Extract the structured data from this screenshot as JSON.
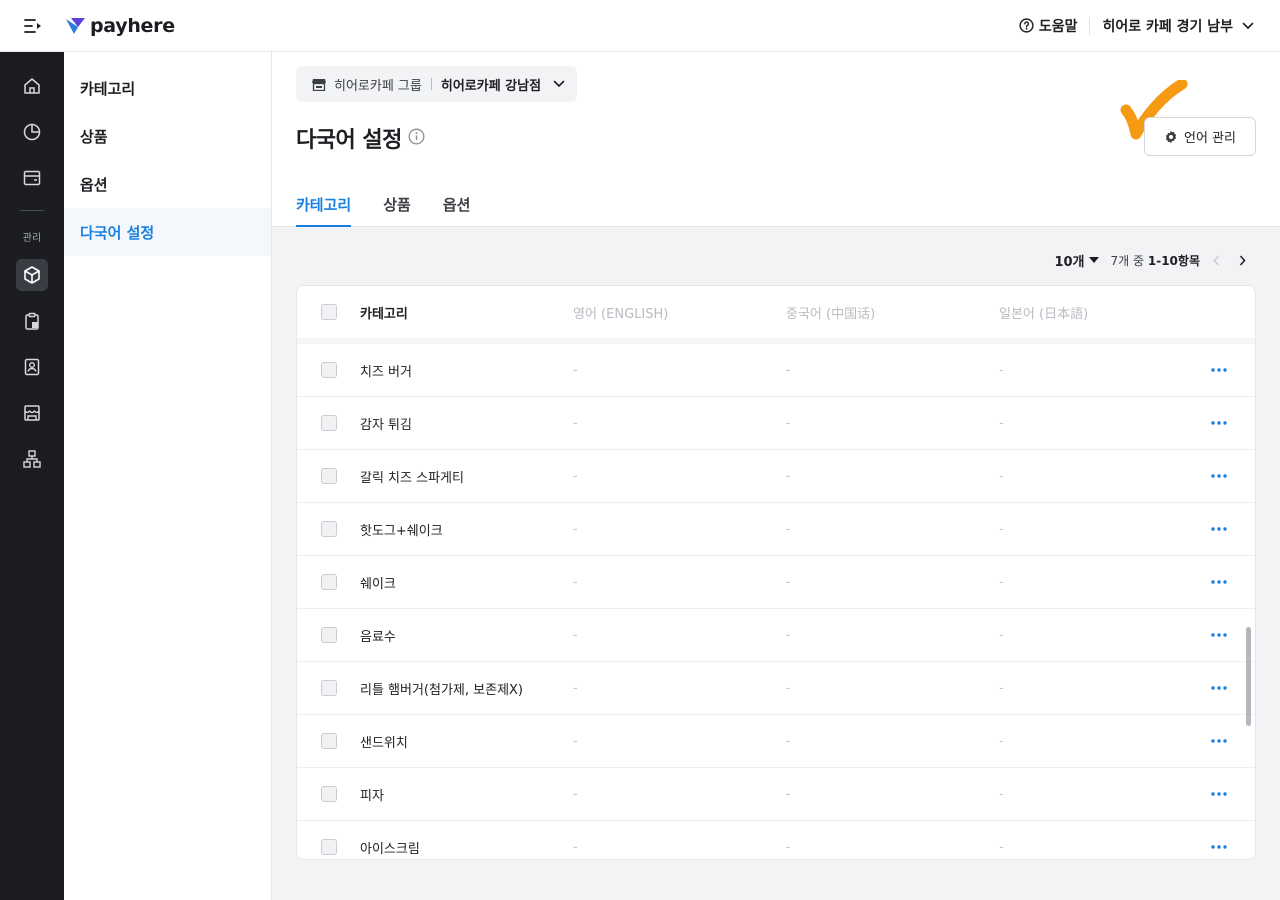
{
  "topbar": {
    "logo_text": "payhere",
    "help_label": "도움말",
    "store_name": "히어로 카페 경기 남부"
  },
  "rail": {
    "section_label": "관리"
  },
  "subnav": {
    "items": [
      {
        "label": "카테고리",
        "active": false
      },
      {
        "label": "상품",
        "active": false
      },
      {
        "label": "옵션",
        "active": false
      },
      {
        "label": "다국어 설정",
        "active": true
      }
    ]
  },
  "store_chip": {
    "group": "히어로카페 그룹",
    "branch": "히어로카페 강남점"
  },
  "page": {
    "title": "다국어 설정",
    "lang_button": "언어 관리"
  },
  "tabs": [
    {
      "label": "카테고리",
      "active": true
    },
    {
      "label": "상품",
      "active": false
    },
    {
      "label": "옵션",
      "active": false
    }
  ],
  "pager": {
    "page_size": "10개",
    "range_prefix": "7개 중 ",
    "range_value": "1-10항목"
  },
  "table": {
    "headers": {
      "category": "카테고리",
      "english": "영어 (ENGLISH)",
      "chinese": "중국어 (中国话)",
      "japanese": "일본어 (日本語)"
    },
    "rows": [
      {
        "category": "치즈 버거",
        "english": "-",
        "chinese": "-",
        "japanese": "-"
      },
      {
        "category": "감자 튀김",
        "english": "-",
        "chinese": "-",
        "japanese": "-"
      },
      {
        "category": "갈릭 치즈 스파게티",
        "english": "-",
        "chinese": "-",
        "japanese": "-"
      },
      {
        "category": "핫도그+쉐이크",
        "english": "-",
        "chinese": "-",
        "japanese": "-"
      },
      {
        "category": "쉐이크",
        "english": "-",
        "chinese": "-",
        "japanese": "-"
      },
      {
        "category": "음료수",
        "english": "-",
        "chinese": "-",
        "japanese": "-"
      },
      {
        "category": "리틀 햄버거(첨가제, 보존제X)",
        "english": "-",
        "chinese": "-",
        "japanese": "-"
      },
      {
        "category": "샌드위치",
        "english": "-",
        "chinese": "-",
        "japanese": "-"
      },
      {
        "category": "피자",
        "english": "-",
        "chinese": "-",
        "japanese": "-"
      },
      {
        "category": "아이스크림",
        "english": "-",
        "chinese": "-",
        "japanese": "-"
      }
    ]
  },
  "colors": {
    "accent": "#1b7fe0",
    "rail_bg": "#1b1d21",
    "checkmark": "#f59a12"
  }
}
